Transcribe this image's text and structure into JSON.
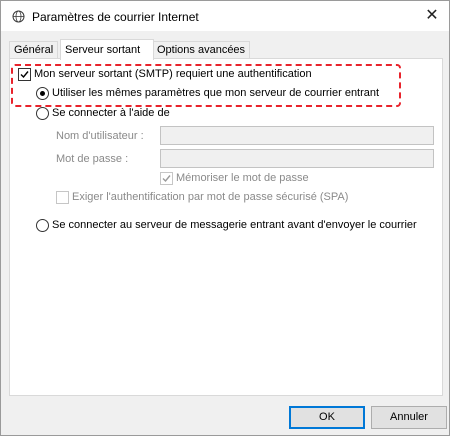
{
  "window": {
    "title": "Paramètres de courrier Internet",
    "close_glyph": "✕"
  },
  "tabs": [
    {
      "label": "Général",
      "active": false
    },
    {
      "label": "Serveur sortant",
      "active": true
    },
    {
      "label": "Options avancées",
      "active": false
    }
  ],
  "outgoing": {
    "smtp_auth_required": {
      "label": "Mon serveur sortant (SMTP) requiert une authentification",
      "checked": true
    },
    "use_same_settings": {
      "label": "Utiliser les mêmes paramètres que mon serveur de courrier entrant",
      "selected": true
    },
    "log_on_using": {
      "label": "Se connecter à l'aide de",
      "selected": false
    },
    "username": {
      "label": "Nom d'utilisateur :",
      "value": ""
    },
    "password": {
      "label": "Mot de passe :",
      "value": ""
    },
    "remember_password": {
      "label": "Mémoriser le mot de passe",
      "checked": true,
      "enabled": false
    },
    "require_spa": {
      "label": "Exiger l'authentification par mot de passe sécurisé (SPA)",
      "checked": false,
      "enabled": false
    },
    "log_on_incoming_first": {
      "label": "Se connecter au serveur de messagerie entrant avant d'envoyer le courrier",
      "selected": false
    }
  },
  "buttons": {
    "ok": "OK",
    "cancel": "Annuler"
  },
  "colors": {
    "highlight": "#e8232c",
    "accent": "#0078d7"
  },
  "icons": {
    "app": "globe-envelope-icon",
    "close": "close-icon"
  }
}
